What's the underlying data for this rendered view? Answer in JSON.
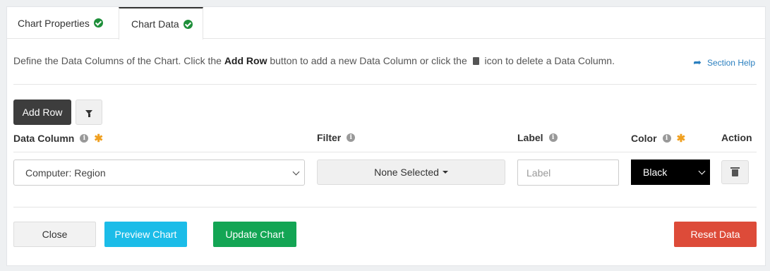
{
  "tabs": [
    {
      "label": "Chart Properties",
      "icon": "check-circle-icon"
    },
    {
      "label": "Chart Data",
      "icon": "check-circle-icon",
      "active": true
    }
  ],
  "intro": {
    "part1": "Define the Data Columns of the Chart. Click the ",
    "bold": "Add Row",
    "part2": " button to add a new Data Column or click the ",
    "part3": " icon to delete a Data Column."
  },
  "section_help": "Section Help",
  "toolbar": {
    "add_row": "Add Row"
  },
  "columns": {
    "data_column": "Data Column",
    "filter": "Filter",
    "label": "Label",
    "color": "Color",
    "action": "Action"
  },
  "row": {
    "data_column_value": "Computer: Region",
    "filter_value": "None Selected",
    "label_placeholder": "Label",
    "label_value": "",
    "color_value": "Black"
  },
  "buttons": {
    "close": "Close",
    "preview": "Preview Chart",
    "update": "Update Chart",
    "reset": "Reset Data"
  },
  "colors": {
    "preview": "#1bbce8",
    "update": "#13a554",
    "reset": "#dd4b39",
    "add_row": "#3d3d3d",
    "required": "#f0a020"
  }
}
